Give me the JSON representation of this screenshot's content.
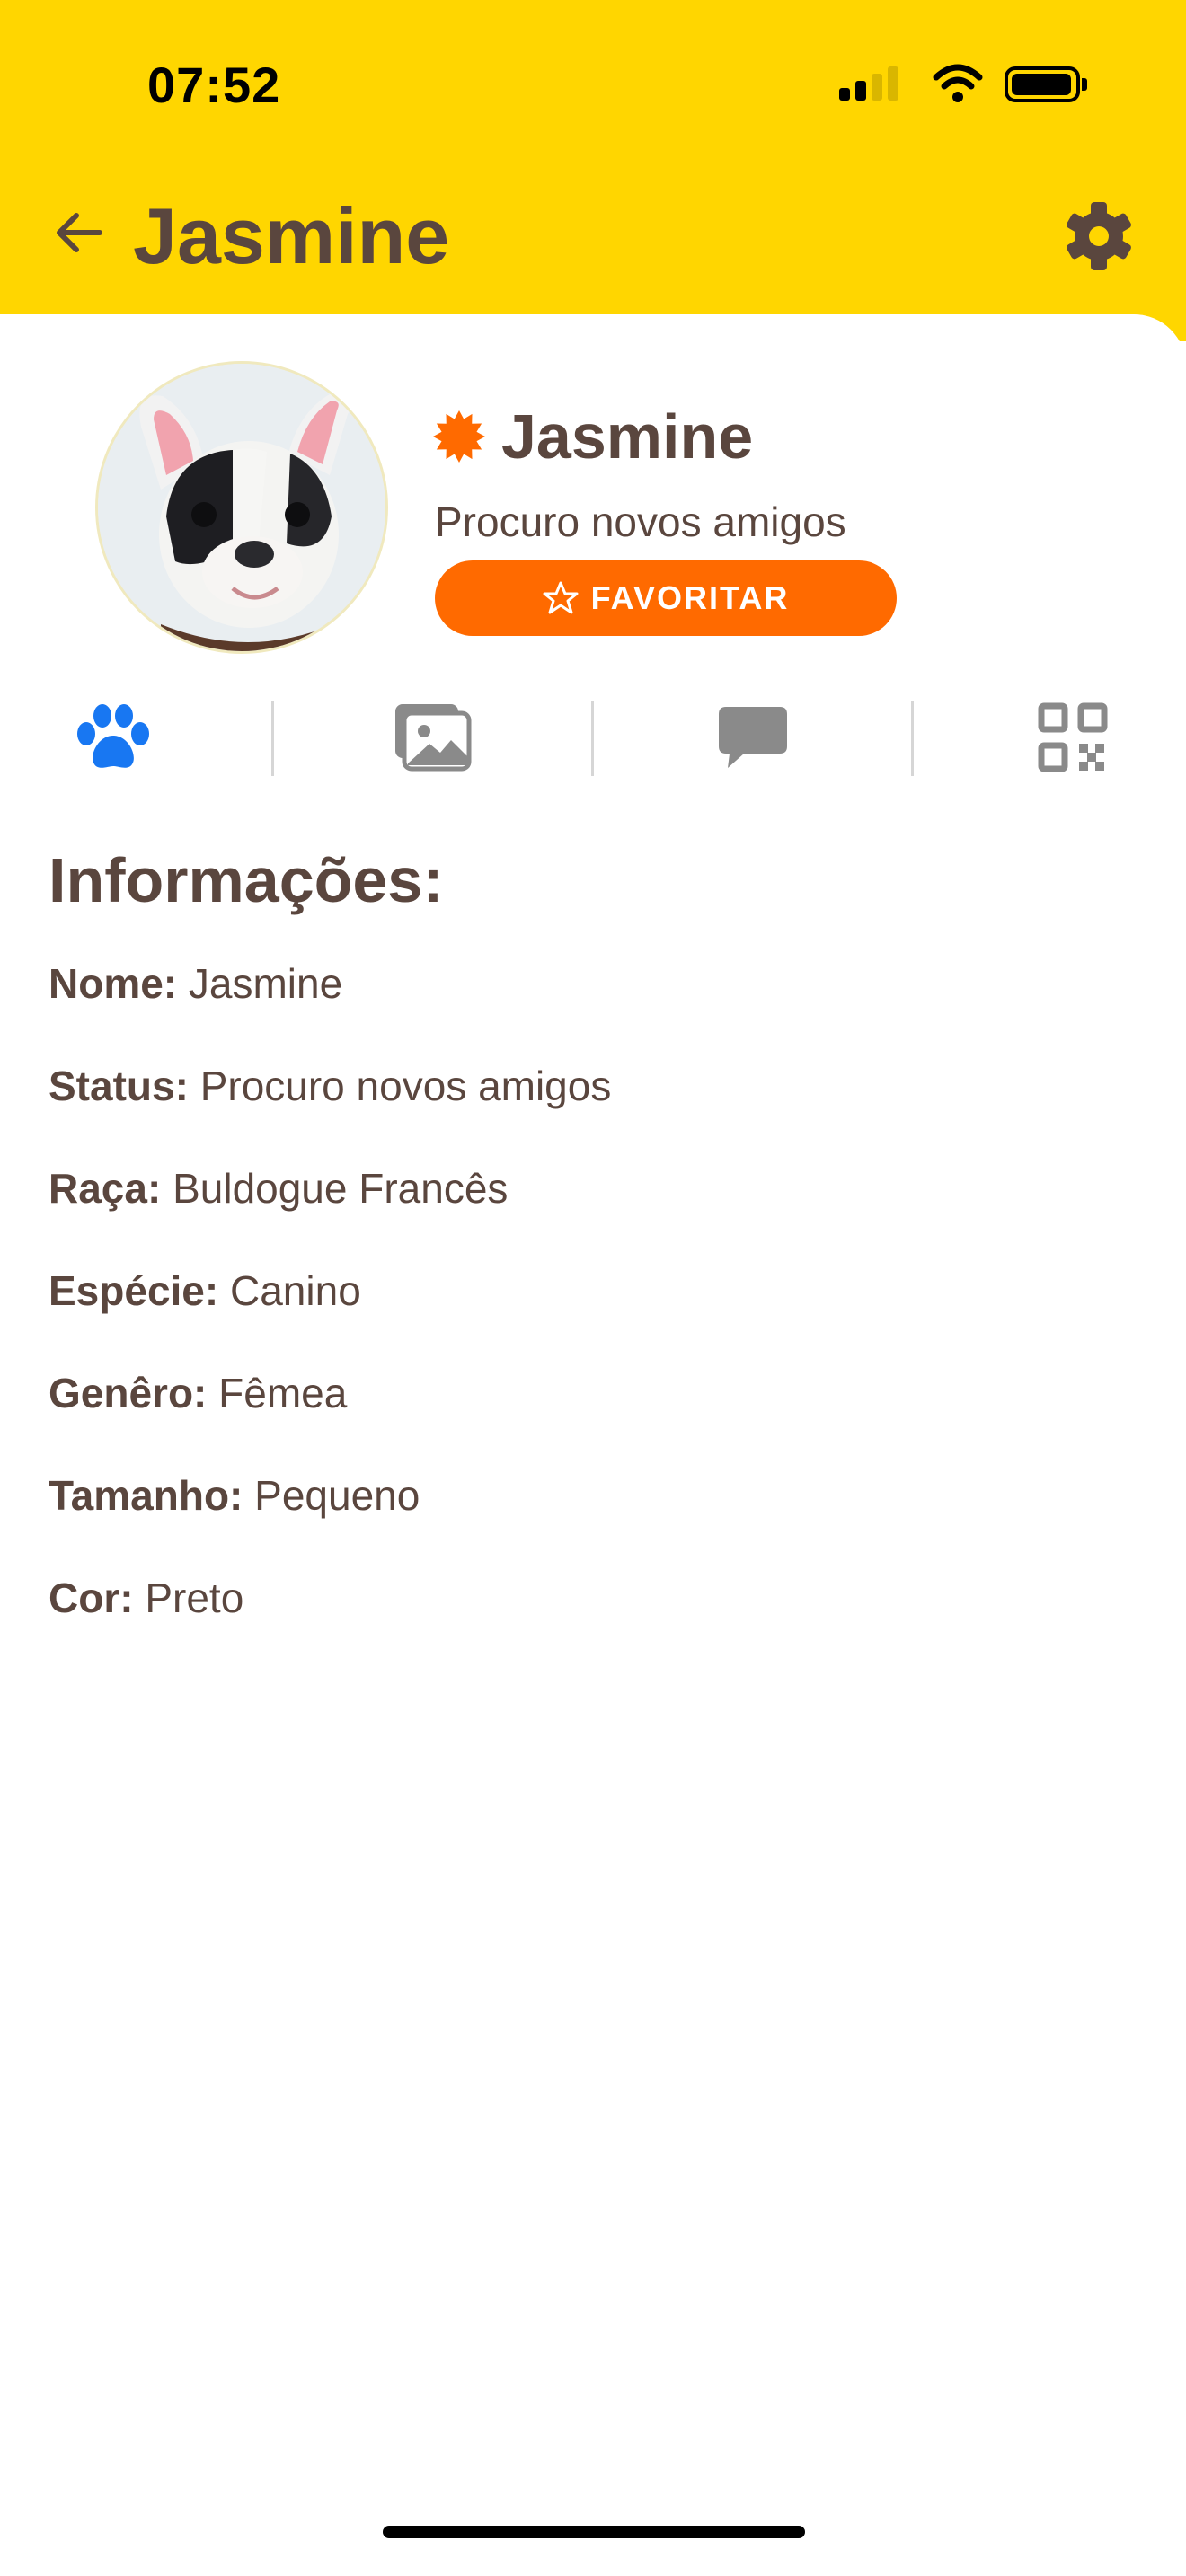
{
  "status_bar": {
    "time": "07:52"
  },
  "header": {
    "title": "Jasmine"
  },
  "profile": {
    "name": "Jasmine",
    "status": "Procuro novos amigos",
    "favorite_label": "FAVORITAR"
  },
  "tabs": [
    {
      "icon": "paw-icon",
      "active": true
    },
    {
      "icon": "gallery-icon",
      "active": false
    },
    {
      "icon": "chat-icon",
      "active": false
    },
    {
      "icon": "qr-code-icon",
      "active": false
    }
  ],
  "info": {
    "title": "Informações:",
    "rows": [
      {
        "label": "Nome:",
        "value": "Jasmine"
      },
      {
        "label": "Status:",
        "value": "Procuro novos amigos"
      },
      {
        "label": "Raça:",
        "value": "Buldogue Francês"
      },
      {
        "label": "Espécie:",
        "value": "Canino"
      },
      {
        "label": "Genêro:",
        "value": "Fêmea"
      },
      {
        "label": "Tamanho:",
        "value": "Pequeno"
      },
      {
        "label": "Cor:",
        "value": "Preto"
      }
    ]
  },
  "colors": {
    "header_bg": "#FFD600",
    "text_brown": "#5A463E",
    "accent_orange": "#FF6A00",
    "active_tab_blue": "#1877F2",
    "inactive_icon_gray": "#8A8A8A"
  }
}
